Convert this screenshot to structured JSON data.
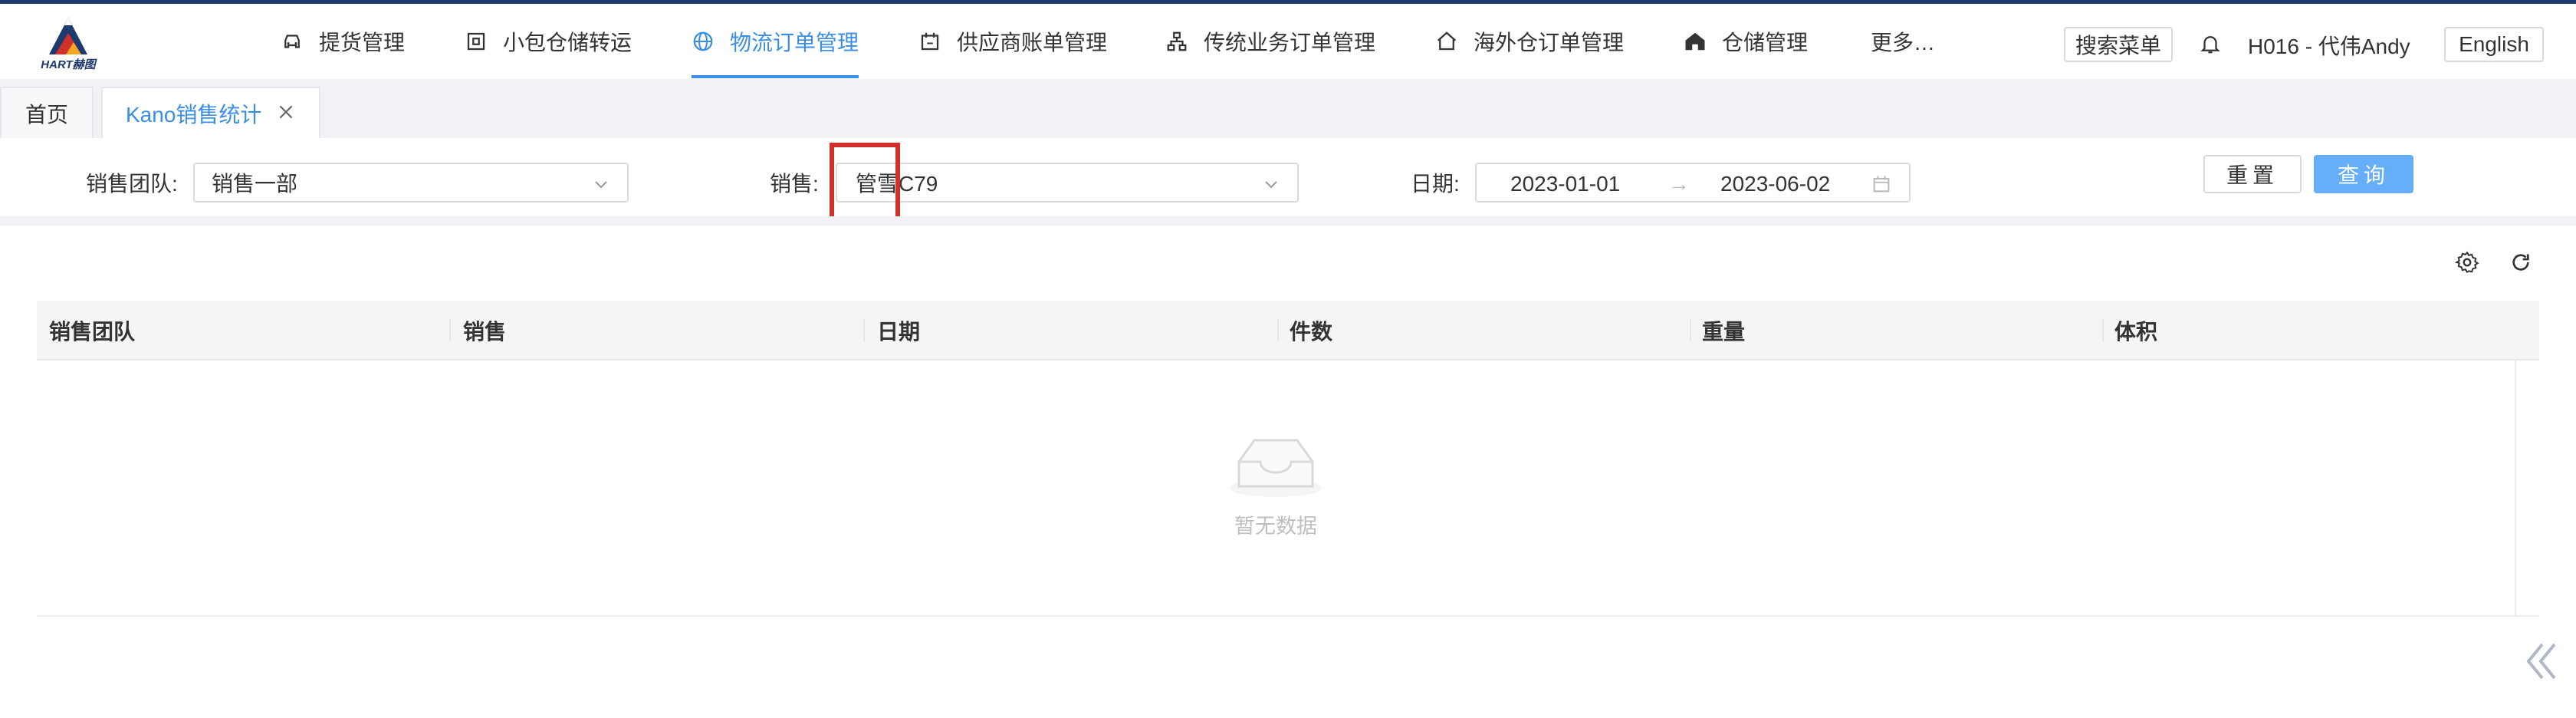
{
  "brand": {
    "logo_text": "HART赫图",
    "logo_colors": [
      "#1e3a6e",
      "#d0312d",
      "#f5a623"
    ]
  },
  "nav": {
    "items": [
      {
        "label": "提货管理",
        "icon": "car-icon",
        "active": false
      },
      {
        "label": "小包仓储转运",
        "icon": "package-icon",
        "active": false
      },
      {
        "label": "物流订单管理",
        "icon": "globe-icon",
        "active": true
      },
      {
        "label": "供应商账单管理",
        "icon": "invoice-icon",
        "active": false
      },
      {
        "label": "传统业务订单管理",
        "icon": "hierarchy-icon",
        "active": false
      },
      {
        "label": "海外仓订单管理",
        "icon": "home-icon",
        "active": false
      },
      {
        "label": "仓储管理",
        "icon": "warehouse-icon",
        "active": false
      },
      {
        "label": "更多…",
        "icon": "",
        "active": false
      }
    ],
    "search_menu_label": "搜索菜单",
    "user_name": "H016 - 代伟Andy",
    "language_label": "English",
    "accent_color": "#3a8ee6"
  },
  "tabs": {
    "home_label": "首页",
    "active_label": "Kano销售统计"
  },
  "filters": {
    "team_label": "销售团队:",
    "team_value": "销售一部",
    "sales_label": "销售:",
    "sales_value": "管雪C79",
    "date_label": "日期:",
    "date_start": "2023-01-01",
    "date_arrow": "→",
    "date_end": "2023-06-02",
    "reset_label": "重置",
    "query_label": "查询"
  },
  "table": {
    "columns": [
      "销售团队",
      "销售",
      "日期",
      "件数",
      "重量",
      "体积"
    ],
    "rows": [],
    "empty_text": "暂无数据"
  },
  "highlight": {
    "color": "#d0312d"
  }
}
